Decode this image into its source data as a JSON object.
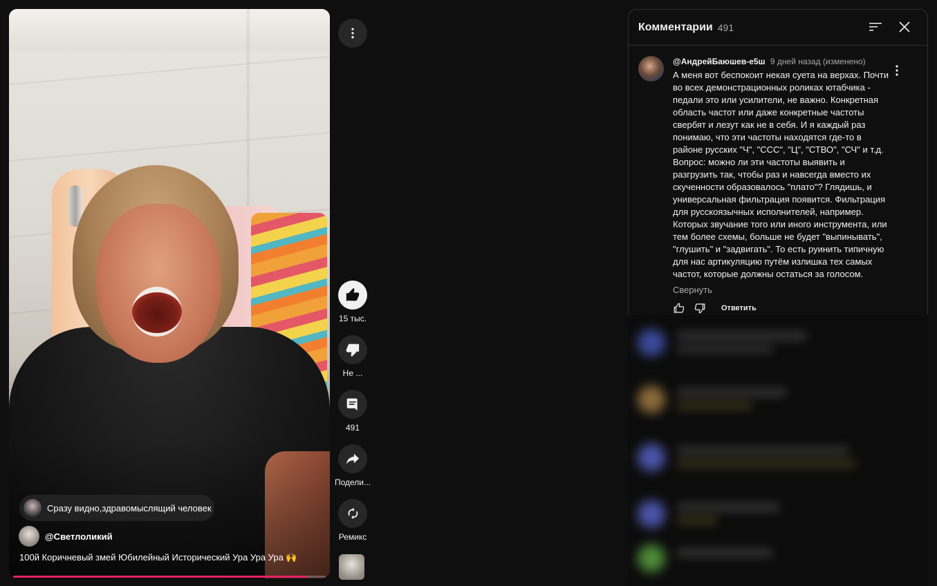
{
  "video": {
    "top_comment_preview": "Сразу видно,здравомыслящий человек",
    "channel_handle": "@Светлоликий",
    "title": "100й Коричневый змей Юбилейный Исторический Ура Ура Ура 🙌",
    "progress": 0.94
  },
  "actions": {
    "like_count": "15 тыс.",
    "dislike_label": "Не ...",
    "comments_count": "491",
    "share_label": "Подели...",
    "remix_label": "Ремикс"
  },
  "comments_panel": {
    "title": "Комментарии",
    "count": "491",
    "comment": {
      "author": "@АндрейБаюшев-е5ш",
      "time": "9 дней назад (изменено)",
      "text_lines": [
        "А меня вот беспокоит некая суета на верхах. Почти",
        "во всех демонстрационных роликах ютабчика -",
        "педали это или усилители, не важно. Конкретная",
        "область частот или даже конкретные частоты",
        "свербят и лезут как не в себя. И я каждый раз",
        "понимаю, что эти частоты находятся где-то в",
        "районе русских \"Ч\", \"ССС\", \"Ц\", \"СТВО\", \"СЧ\" и т.д.",
        "Вопрос: можно ли эти частоты выявить и",
        "разгрузить так, чтобы раз и навсегда вместо их",
        "скученности образовалось \"плато\"? Глядишь, и",
        "универсальная фильтрация появится. Фильтрация",
        "для русскоязычных исполнителей, например.",
        "Которых звучание того или иного инструмента, или",
        "тем более схемы, больше не будет \"выпинывать\",",
        "\"глушить\" и \"задвигать\". То есть руинить типичную",
        "для нас артикуляцию путём излишка тех самых",
        "частот, которые должны остаться за голосом."
      ],
      "collapse_label": "Свернуть",
      "reply_label": "Ответить"
    }
  },
  "colors": {
    "background": "#0f0f0f",
    "progress_fill": "#e8206a",
    "secondary_text": "#aaaaaa"
  },
  "icons": [
    "more-vert-icon",
    "thumb-up-icon",
    "thumb-down-icon",
    "comment-icon",
    "share-icon",
    "remix-icon",
    "sort-icon",
    "close-icon"
  ]
}
